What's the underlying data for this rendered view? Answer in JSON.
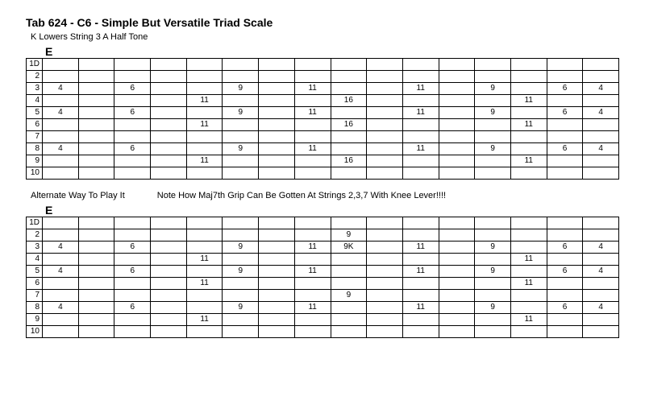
{
  "title": "Tab 624 - C6 - Simple But Versatile Triad Scale",
  "subtitle": "K Lowers String 3 A Half Tone",
  "chord": "E",
  "between": {
    "left": "Alternate Way To Play It",
    "right": "Note How Maj7th Grip Can Be Gotten At Strings 2,3,7 With Knee Lever!!!!"
  },
  "row_labels": [
    "1D",
    "2",
    "3",
    "4",
    "5",
    "6",
    "7",
    "8",
    "9",
    "10"
  ],
  "columns": 16,
  "tab1": {
    "rows": [
      {
        "label": "1D",
        "cells": [
          "",
          "",
          "",
          "",
          "",
          "",
          "",
          "",
          "",
          "",
          "",
          "",
          "",
          "",
          "",
          ""
        ]
      },
      {
        "label": "2",
        "cells": [
          "",
          "",
          "",
          "",
          "",
          "",
          "",
          "",
          "",
          "",
          "",
          "",
          "",
          "",
          "",
          ""
        ]
      },
      {
        "label": "3",
        "cells": [
          "4",
          "",
          "6",
          "",
          "",
          "9",
          "",
          "11",
          "",
          "",
          "11",
          "",
          "9",
          "",
          "6",
          "4"
        ]
      },
      {
        "label": "4",
        "cells": [
          "",
          "",
          "",
          "",
          "11",
          "",
          "",
          "",
          "16",
          "",
          "",
          "",
          "",
          "11",
          "",
          ""
        ]
      },
      {
        "label": "5",
        "cells": [
          "4",
          "",
          "6",
          "",
          "",
          "9",
          "",
          "11",
          "",
          "",
          "11",
          "",
          "9",
          "",
          "6",
          "4"
        ]
      },
      {
        "label": "6",
        "cells": [
          "",
          "",
          "",
          "",
          "11",
          "",
          "",
          "",
          "16",
          "",
          "",
          "",
          "",
          "11",
          "",
          ""
        ]
      },
      {
        "label": "7",
        "cells": [
          "",
          "",
          "",
          "",
          "",
          "",
          "",
          "",
          "",
          "",
          "",
          "",
          "",
          "",
          "",
          ""
        ]
      },
      {
        "label": "8",
        "cells": [
          "4",
          "",
          "6",
          "",
          "",
          "9",
          "",
          "11",
          "",
          "",
          "11",
          "",
          "9",
          "",
          "6",
          "4"
        ]
      },
      {
        "label": "9",
        "cells": [
          "",
          "",
          "",
          "",
          "11",
          "",
          "",
          "",
          "16",
          "",
          "",
          "",
          "",
          "11",
          "",
          ""
        ]
      },
      {
        "label": "10",
        "cells": [
          "",
          "",
          "",
          "",
          "",
          "",
          "",
          "",
          "",
          "",
          "",
          "",
          "",
          "",
          "",
          ""
        ]
      }
    ]
  },
  "tab2": {
    "rows": [
      {
        "label": "1D",
        "cells": [
          "",
          "",
          "",
          "",
          "",
          "",
          "",
          "",
          "",
          "",
          "",
          "",
          "",
          "",
          "",
          ""
        ]
      },
      {
        "label": "2",
        "cells": [
          "",
          "",
          "",
          "",
          "",
          "",
          "",
          "",
          "9",
          "",
          "",
          "",
          "",
          "",
          "",
          ""
        ]
      },
      {
        "label": "3",
        "cells": [
          "4",
          "",
          "6",
          "",
          "",
          "9",
          "",
          "11",
          "9K",
          "",
          "11",
          "",
          "9",
          "",
          "6",
          "4"
        ]
      },
      {
        "label": "4",
        "cells": [
          "",
          "",
          "",
          "",
          "11",
          "",
          "",
          "",
          "",
          "",
          "",
          "",
          "",
          "11",
          "",
          ""
        ]
      },
      {
        "label": "5",
        "cells": [
          "4",
          "",
          "6",
          "",
          "",
          "9",
          "",
          "11",
          "",
          "",
          "11",
          "",
          "9",
          "",
          "6",
          "4"
        ]
      },
      {
        "label": "6",
        "cells": [
          "",
          "",
          "",
          "",
          "11",
          "",
          "",
          "",
          "",
          "",
          "",
          "",
          "",
          "11",
          "",
          ""
        ]
      },
      {
        "label": "7",
        "cells": [
          "",
          "",
          "",
          "",
          "",
          "",
          "",
          "",
          "9",
          "",
          "",
          "",
          "",
          "",
          "",
          ""
        ]
      },
      {
        "label": "8",
        "cells": [
          "4",
          "",
          "6",
          "",
          "",
          "9",
          "",
          "11",
          "",
          "",
          "11",
          "",
          "9",
          "",
          "6",
          "4"
        ]
      },
      {
        "label": "9",
        "cells": [
          "",
          "",
          "",
          "",
          "11",
          "",
          "",
          "",
          "",
          "",
          "",
          "",
          "",
          "11",
          "",
          ""
        ]
      },
      {
        "label": "10",
        "cells": [
          "",
          "",
          "",
          "",
          "",
          "",
          "",
          "",
          "",
          "",
          "",
          "",
          "",
          "",
          "",
          ""
        ]
      }
    ]
  }
}
